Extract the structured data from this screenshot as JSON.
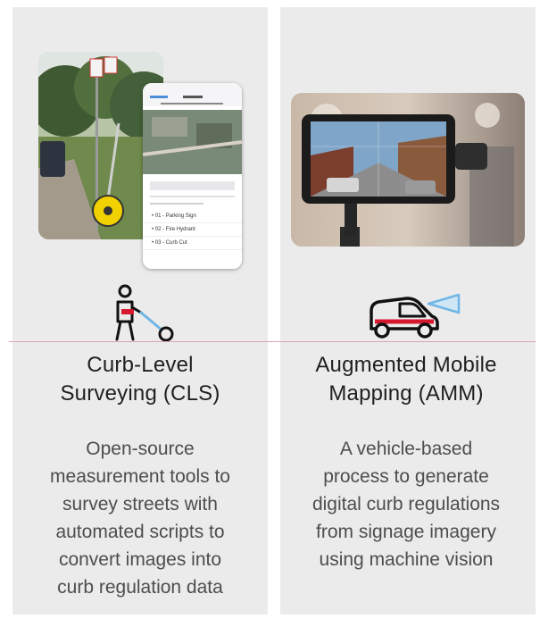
{
  "columns": [
    {
      "title_lines": [
        "Curb-Level",
        "Surveying (CLS)"
      ],
      "description_lines": [
        "Open-source",
        "measurement tools to",
        "survey streets with",
        "automated scripts to",
        "convert images into",
        "curb regulation data"
      ],
      "icon": "surveyor-measuring-wheel-icon",
      "phone_list_items": [
        "01 - Parking Sign",
        "02 - Fire Hydrant",
        "03 - Curb Cut"
      ]
    },
    {
      "title_lines": [
        "Augmented Mobile",
        "Mapping (AMM)"
      ],
      "description_lines": [
        "A vehicle-based",
        "process to generate",
        "digital curb regulations",
        "from signage imagery",
        "using machine vision"
      ],
      "icon": "car-with-camera-icon"
    }
  ],
  "colors": {
    "panel_background": "#ebebeb",
    "accent_red": "#d7192f",
    "camera_beam_blue": "#6fb6e6",
    "measuring_wheel_yellow": "#f2d100",
    "divider_pink": "#d9a7b3"
  }
}
